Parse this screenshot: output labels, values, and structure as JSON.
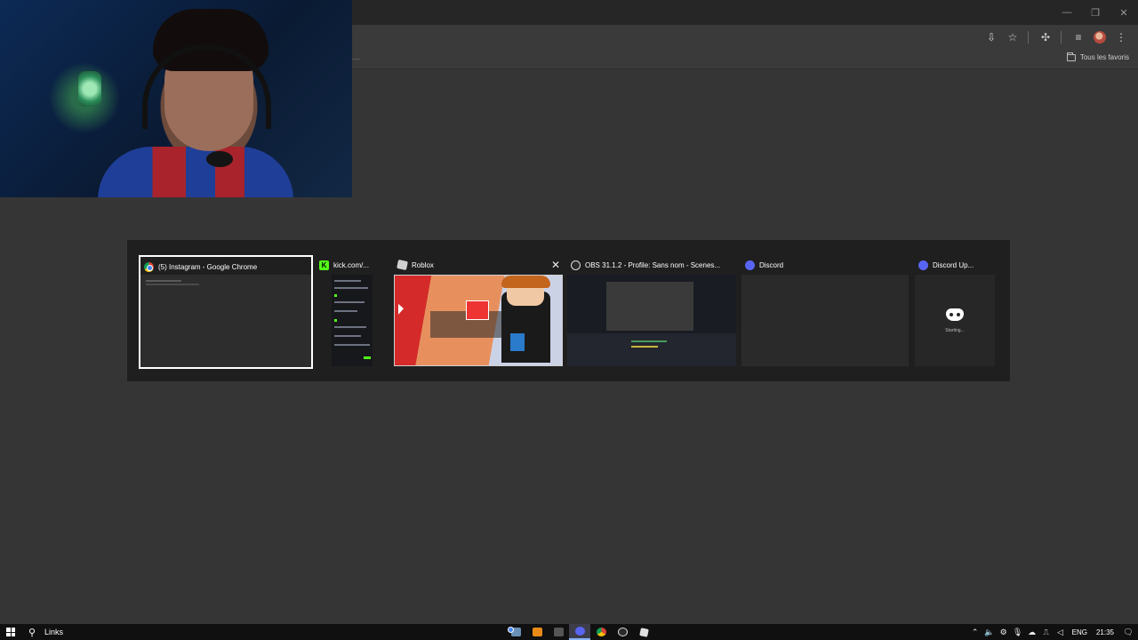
{
  "browser": {
    "bookmarks_overflow": "....",
    "all_bookmarks_label": "Tous les favoris"
  },
  "switcher": {
    "tasks": [
      {
        "title": "(5) Instagram - Google Chrome",
        "icon": "chrome-icon",
        "selected": true
      },
      {
        "title": "kick.com/...",
        "icon": "kick-icon"
      },
      {
        "title": "Roblox",
        "icon": "roblox-icon",
        "close_label": "✕"
      },
      {
        "title": "OBS 31.1.2 - Profile: Sans nom - Scenes...",
        "icon": "obs-icon"
      },
      {
        "title": "Discord",
        "icon": "discord-icon"
      },
      {
        "title": "Discord Up...",
        "icon": "discord-icon",
        "thumb_text": "Starting..."
      }
    ]
  },
  "taskbar": {
    "search_text": "Links",
    "tray": {
      "language": "ENG",
      "time": "21:35"
    }
  },
  "colors": {
    "switcher_bg": "#1f1f1f",
    "desktop_bg": "#3b3b3b",
    "taskbar_bg": "#101010",
    "discord": "#5865f2",
    "kick": "#53fc18"
  }
}
